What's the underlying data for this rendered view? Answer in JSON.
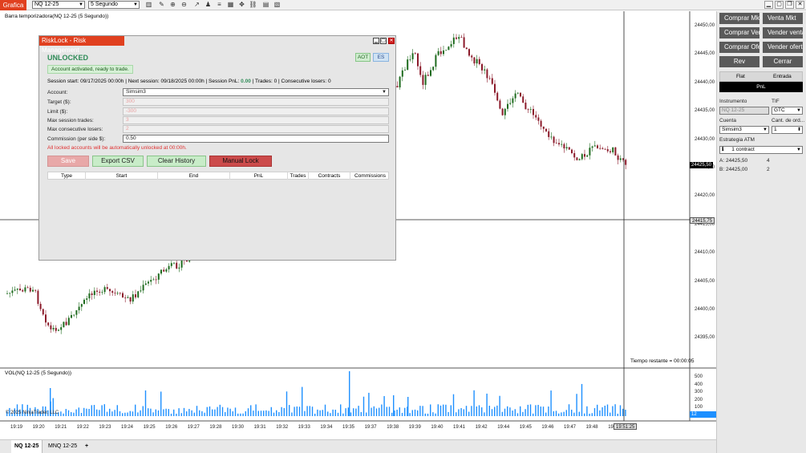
{
  "toolbar": {
    "app_tab": "Grafica",
    "instrument": "NQ 12-25",
    "interval": "5 Segundo"
  },
  "chart": {
    "bar_type_label": "Barra temporizadora(NQ 12-25 (5 Segundo))",
    "volume_label": "VOL(NQ 12-25 (5 Segundo))",
    "copyright": "© 2025 NinjaTrader, LLC",
    "remaining_time": "Tiempo restante = 00:00:05",
    "price_ticks": [
      "24450,00",
      "24445,00",
      "24440,00",
      "24435,00",
      "24430,00",
      "24425,00",
      "24420,00",
      "24415,00",
      "24410,00",
      "24405,00",
      "24400,00",
      "24395,00"
    ],
    "current_price_tag": "24425,50",
    "crosshair_price_tag": "24415,75",
    "volume_ticks": [
      "500",
      "400",
      "300",
      "200",
      "100"
    ],
    "volume_tag": "12",
    "time_ticks": [
      "19:19",
      "19:20",
      "19:21",
      "19:22",
      "19:23",
      "19:24",
      "19:25",
      "19:26",
      "19:27",
      "19:28",
      "19:30",
      "19:31",
      "19:32",
      "19:33",
      "19:34",
      "19:35",
      "19:37",
      "19:38",
      "19:39",
      "19:40",
      "19:41",
      "19:42",
      "19:44",
      "19:45",
      "19:46",
      "19:47",
      "19:48",
      "19:49"
    ],
    "crosshair_time": "19:51:25",
    "colors": {
      "up": "#1e6b1e",
      "down": "#8b1a2a",
      "volume": "#1e90ff",
      "accent": "#e0401f"
    }
  },
  "bottom_tabs": [
    {
      "label": "NQ 12-25",
      "active": true
    },
    {
      "label": "MNQ 12-25",
      "active": false
    }
  ],
  "add_tab_icon": "+",
  "right_panel": {
    "buttons": [
      "Comprar Mkt",
      "Venta Mkt",
      "Comprar Venta",
      "Vender venta",
      "Comprar Oferta",
      "Vender oferta",
      "Rev",
      "Cerrar"
    ],
    "flat_label": "Flat",
    "entrada_label": "Entrada",
    "pnl_label": "PnL",
    "instrumento_label": "Instrumento",
    "instrumento_value": "NQ 12-25",
    "tif_label": "TIF",
    "tif_value": "GTC",
    "cuenta_label": "Cuenta",
    "cuenta_value": "Simsim3",
    "cantidad_label": "Cant. de ord...",
    "cantidad_value": "1",
    "atm_label": "Estrategia ATM",
    "atm_value": "1 contract",
    "ask_label": "A:",
    "ask_price": "24425,50",
    "ask_size": "4",
    "bid_label": "B:",
    "bid_price": "24425,00",
    "bid_size": "2"
  },
  "dialog": {
    "title": "RiskLock - Risk Management",
    "status": "UNLOCKED",
    "aot_label": "AOT",
    "lang_label": "ES",
    "activated_msg": "Account activated, ready to trade.",
    "session_info": "Session start: 09/17/2025 00:00h | Next session: 09/18/2025 00:00h | Session PnL: ",
    "session_pnl": "0.00",
    "session_info_tail": " | Trades: 0 | Consecutive losers: 0",
    "fields": [
      {
        "label": "Account:",
        "value": "Simsim3"
      },
      {
        "label": "Target ($):",
        "value": "300"
      },
      {
        "label": "Limit ($):",
        "value": "-300"
      },
      {
        "label": "Max session trades:",
        "value": "3"
      },
      {
        "label": "Max consecutive losers:",
        "value": "2"
      },
      {
        "label": "Commission (per side $):",
        "value": "0.50"
      }
    ],
    "warning": "All locked accounts will be automatically unlocked at 00:00h.",
    "save_label": "Save",
    "export_label": "Export CSV",
    "clear_label": "Clear History",
    "lock_label": "Manual Lock",
    "table_headers": [
      "Type",
      "Start",
      "End",
      "PnL",
      "Trades",
      "Contracts",
      "Commissions"
    ]
  }
}
